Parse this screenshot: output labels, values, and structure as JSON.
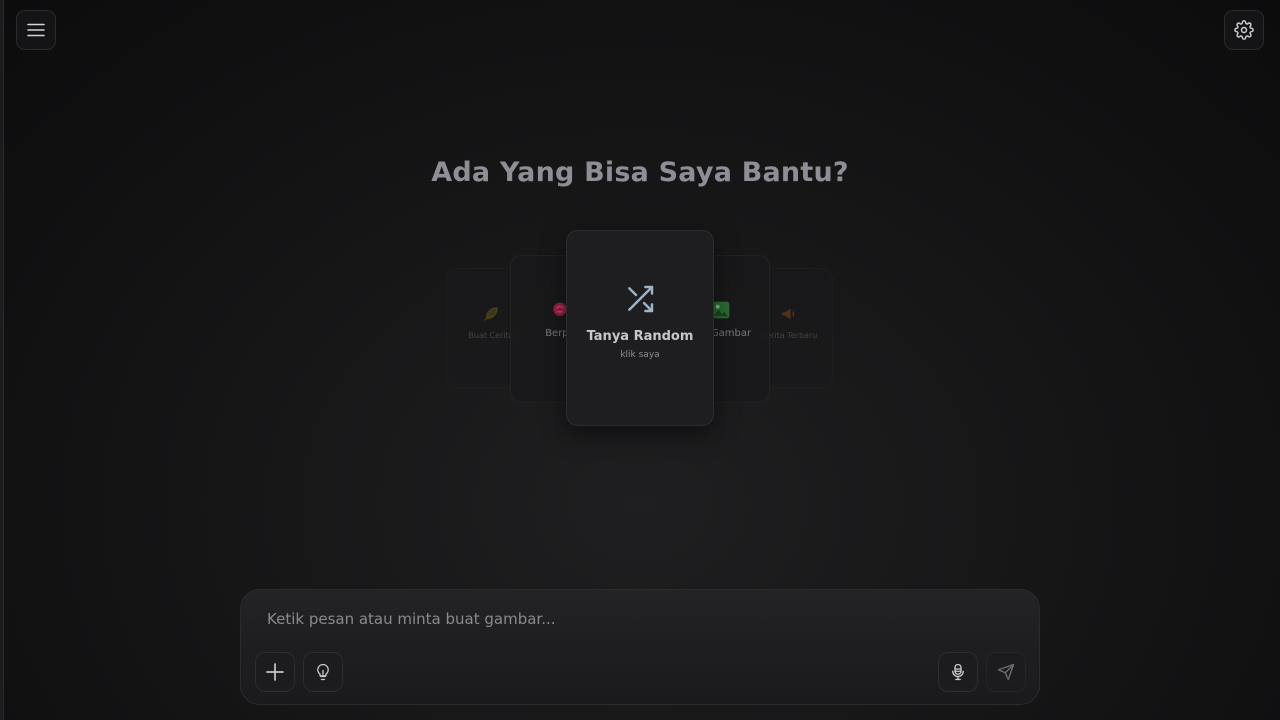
{
  "header": {
    "menu_icon": "hamburger-menu-icon",
    "settings_icon": "gear-icon"
  },
  "main": {
    "title": "Ada Yang Bisa Saya Bantu?"
  },
  "suggestions": {
    "cards": [
      {
        "label": "Buat Cerita",
        "icon": "feather-icon",
        "color": "#7a6a1e"
      },
      {
        "label": "Berpe",
        "icon": "rose-icon",
        "color": "#c2254f"
      },
      {
        "title": "Tanya Random",
        "subtitle": "klik saya",
        "icon": "shuffle-icon",
        "color": "#9fb4c4"
      },
      {
        "label": "Gambar",
        "icon": "image-icon",
        "color": "#3c8a45"
      },
      {
        "label": "Berita Terbaru",
        "icon": "megaphone-icon",
        "color": "#8a4a1e"
      }
    ]
  },
  "composer": {
    "placeholder": "Ketik pesan atau minta buat gambar...",
    "value": "",
    "add_icon": "plus-icon",
    "ideas_icon": "lightbulb-icon",
    "mic_icon": "microphone-icon",
    "send_icon": "send-icon"
  }
}
